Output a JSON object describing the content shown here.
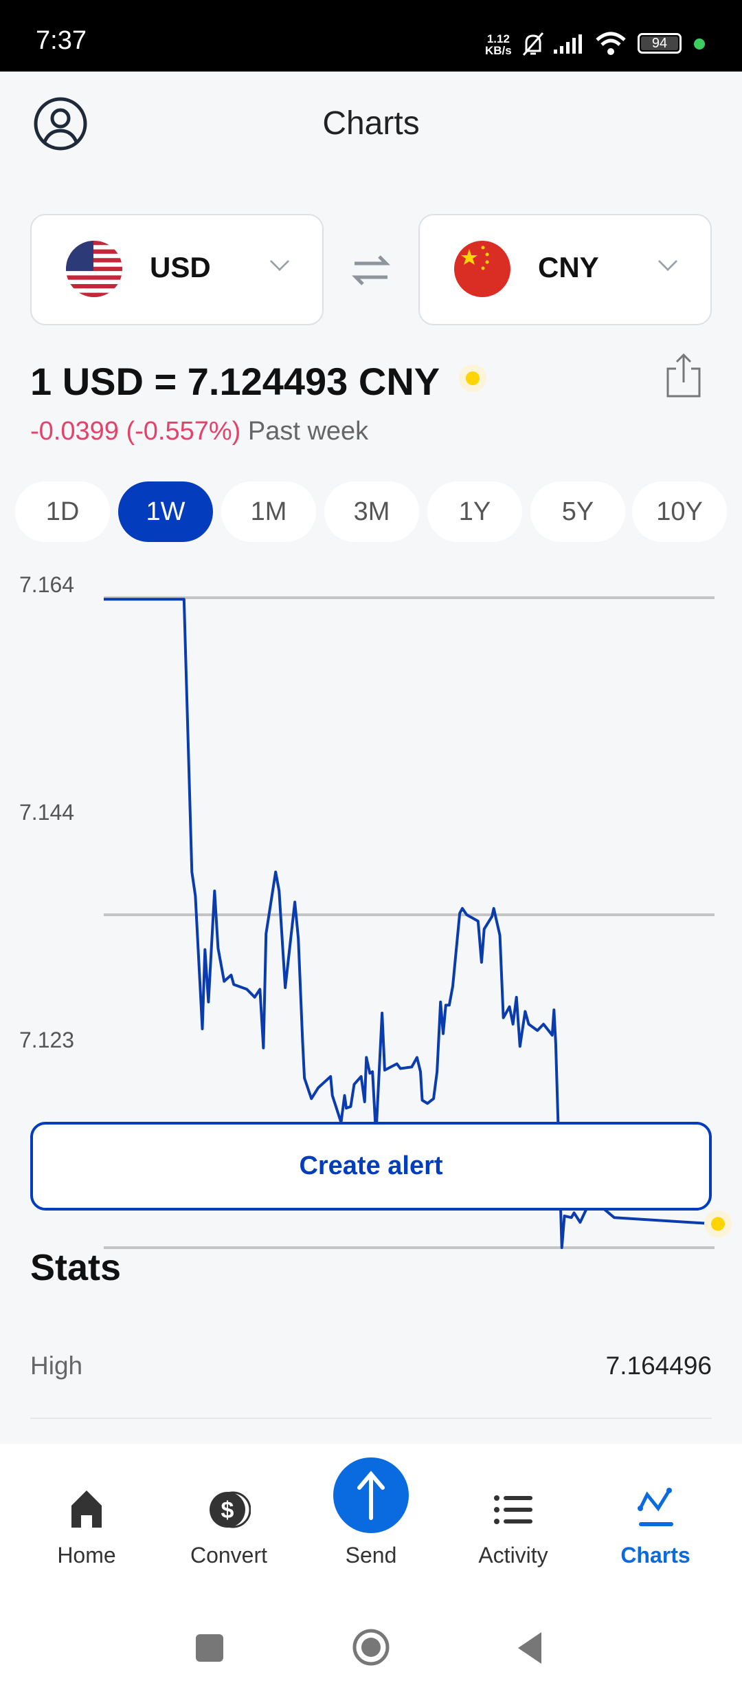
{
  "status_bar": {
    "time": "7:37",
    "net_speed_value": "1.12",
    "net_speed_unit": "KB/s",
    "battery": "94"
  },
  "header": {
    "title": "Charts"
  },
  "from_currency": {
    "code": "USD",
    "flag": "us-flag-icon"
  },
  "to_currency": {
    "code": "CNY",
    "flag": "cn-flag-icon"
  },
  "rate": {
    "text": "1 USD = 7.124493 CNY",
    "change": "-0.0399 (-0.557%)",
    "period": "Past week"
  },
  "periods": [
    "1D",
    "1W",
    "1M",
    "3M",
    "1Y",
    "5Y",
    "10Y"
  ],
  "selected_period": "1W",
  "colors": {
    "accent": "#033cbd",
    "line": "#0a3cad",
    "negative": "#e5416a",
    "nav_active": "#0a6be0",
    "live_dot": "#ffd400"
  },
  "chart_data": {
    "type": "line",
    "ylim": [
      7.123,
      7.164
    ],
    "y_ticks": [
      "7.164",
      "7.144",
      "7.123"
    ],
    "y_tick_values": [
      7.164,
      7.144,
      7.123
    ],
    "x_unit": "days",
    "xlim": [
      0,
      7
    ],
    "grid": true,
    "series": [
      {
        "points": [
          [
            0,
            7.1639
          ],
          [
            0.92,
            7.1639
          ],
          [
            1.01,
            7.1467
          ],
          [
            1.05,
            7.1452
          ],
          [
            1.13,
            7.1368
          ],
          [
            1.16,
            7.1418
          ],
          [
            1.2,
            7.1385
          ],
          [
            1.27,
            7.1455
          ],
          [
            1.31,
            7.1419
          ],
          [
            1.38,
            7.1398
          ],
          [
            1.46,
            7.1402
          ],
          [
            1.49,
            7.1396
          ],
          [
            1.64,
            7.1393
          ],
          [
            1.73,
            7.1388
          ],
          [
            1.79,
            7.1393
          ],
          [
            1.83,
            7.1356
          ],
          [
            1.86,
            7.1428
          ],
          [
            1.97,
            7.1467
          ],
          [
            2.01,
            7.1455
          ],
          [
            2.08,
            7.1394
          ],
          [
            2.19,
            7.1448
          ],
          [
            2.23,
            7.1425
          ],
          [
            2.28,
            7.1359
          ],
          [
            2.3,
            7.1337
          ],
          [
            2.38,
            7.1324
          ],
          [
            2.46,
            7.1331
          ],
          [
            2.6,
            7.1338
          ],
          [
            2.62,
            7.1326
          ],
          [
            2.72,
            7.1309
          ],
          [
            2.76,
            7.1326
          ],
          [
            2.78,
            7.1318
          ],
          [
            2.83,
            7.1319
          ],
          [
            2.87,
            7.1333
          ],
          [
            2.95,
            7.1338
          ],
          [
            2.99,
            7.1322
          ],
          [
            3.01,
            7.135
          ],
          [
            3.05,
            7.134
          ],
          [
            3.08,
            7.1341
          ],
          [
            3.12,
            7.1301
          ],
          [
            3.19,
            7.1378
          ],
          [
            3.22,
            7.1342
          ],
          [
            3.36,
            7.1346
          ],
          [
            3.4,
            7.1343
          ],
          [
            3.53,
            7.1344
          ],
          [
            3.59,
            7.135
          ],
          [
            3.63,
            7.1341
          ],
          [
            3.65,
            7.1323
          ],
          [
            3.71,
            7.1321
          ],
          [
            3.78,
            7.1324
          ],
          [
            3.82,
            7.1341
          ],
          [
            3.86,
            7.1385
          ],
          [
            3.89,
            7.1365
          ],
          [
            3.92,
            7.1383
          ],
          [
            3.96,
            7.1383
          ],
          [
            4.0,
            7.1395
          ],
          [
            4.08,
            7.1441
          ],
          [
            4.11,
            7.1444
          ],
          [
            4.16,
            7.144
          ],
          [
            4.29,
            7.1436
          ],
          [
            4.33,
            7.141
          ],
          [
            4.36,
            7.1431
          ],
          [
            4.45,
            7.1439
          ],
          [
            4.47,
            7.1444
          ],
          [
            4.54,
            7.1427
          ],
          [
            4.58,
            7.1375
          ],
          [
            4.65,
            7.1382
          ],
          [
            4.69,
            7.1371
          ],
          [
            4.73,
            7.1388
          ],
          [
            4.77,
            7.1357
          ],
          [
            4.83,
            7.1379
          ],
          [
            4.87,
            7.1371
          ],
          [
            4.97,
            7.1367
          ],
          [
            5.04,
            7.1371
          ],
          [
            5.14,
            7.1364
          ],
          [
            5.16,
            7.138
          ],
          [
            5.18,
            7.1359
          ],
          [
            5.25,
            7.123
          ],
          [
            5.28,
            7.125
          ],
          [
            5.36,
            7.1249
          ],
          [
            5.39,
            7.1252
          ],
          [
            5.46,
            7.1246
          ],
          [
            5.58,
            7.126
          ],
          [
            5.61,
            7.1258
          ],
          [
            5.69,
            7.1262
          ],
          [
            5.72,
            7.1255
          ],
          [
            5.85,
            7.1249
          ],
          [
            7.0,
            7.1245
          ]
        ]
      }
    ]
  },
  "alert_button": "Create alert",
  "stats": {
    "title": "Stats",
    "rows": [
      {
        "label": "High",
        "value": "7.164496"
      }
    ]
  },
  "nav": [
    {
      "label": "Home",
      "icon": "home-icon"
    },
    {
      "label": "Convert",
      "icon": "dollar-coin-icon"
    },
    {
      "label": "Send",
      "icon": "arrow-up-icon"
    },
    {
      "label": "Activity",
      "icon": "list-icon"
    },
    {
      "label": "Charts",
      "icon": "chart-line-icon",
      "active": true
    }
  ]
}
